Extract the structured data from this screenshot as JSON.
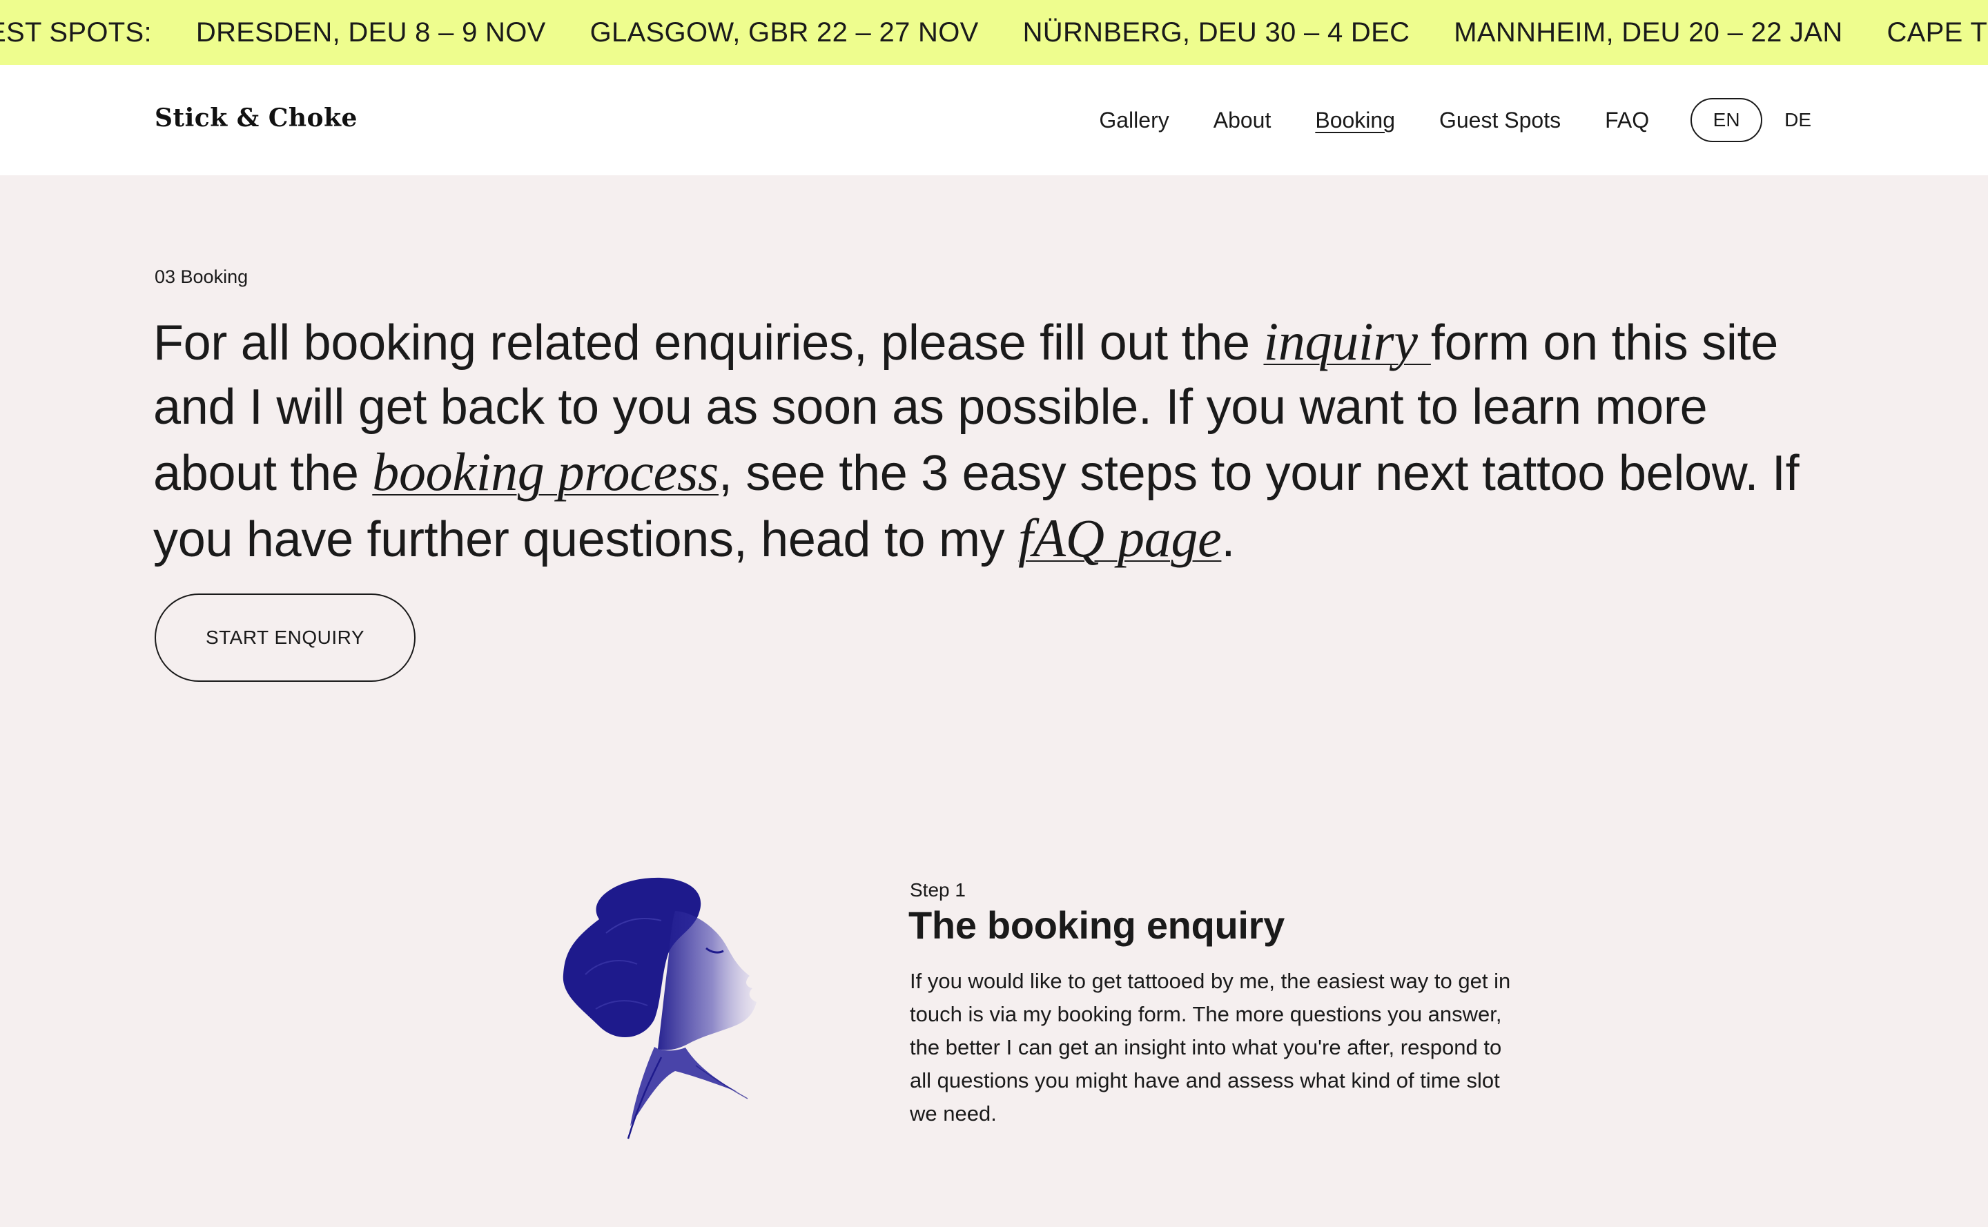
{
  "ticker": {
    "items": [
      "EST SPOTS:",
      "DRESDEN, DEU 8 – 9 NOV",
      "GLASGOW, GBR 22 – 27 NOV",
      "NÜRNBERG, DEU 30 – 4 DEC",
      "MANNHEIM, DEU 20 – 22 JAN",
      "CAPE TOWN, ZA"
    ],
    "background": "#eefd8e"
  },
  "header": {
    "logo": "Stick & Choke",
    "nav": [
      "Gallery",
      "About",
      "Booking",
      "Guest Spots",
      "FAQ"
    ],
    "active_nav": "Booking",
    "lang_en": "EN",
    "lang_de": "DE"
  },
  "intro": {
    "section_label": "03 Booking",
    "text_1": "For all booking related enquiries, please fill out the ",
    "link_inquiry": "inquiry ",
    "text_2": "form on this site and I will get back to you as soon as possible. If you want to learn more about the ",
    "link_booking_process": "booking process",
    "text_3": ", see the 3 easy steps to your next tattoo below. If you have further questions, head to my ",
    "link_faq": "fAQ page",
    "text_4": ".",
    "cta_label": "START ENQUIRY"
  },
  "step1": {
    "label": "Step 1",
    "title": "The booking enquiry",
    "body": "If you would like to get tattooed by me, the easiest way to get in touch is via my booking form. The more questions you answer, the better I can get an insight into what you're after, respond to all questions you might have and assess what kind of time slot we need.",
    "illustration_icon": "woman-profile-illustration",
    "illustration_color": "#1e1a8c"
  },
  "colors": {
    "page_background": "#f5efef",
    "header_background": "#ffffff",
    "text": "#1a1a1a"
  }
}
